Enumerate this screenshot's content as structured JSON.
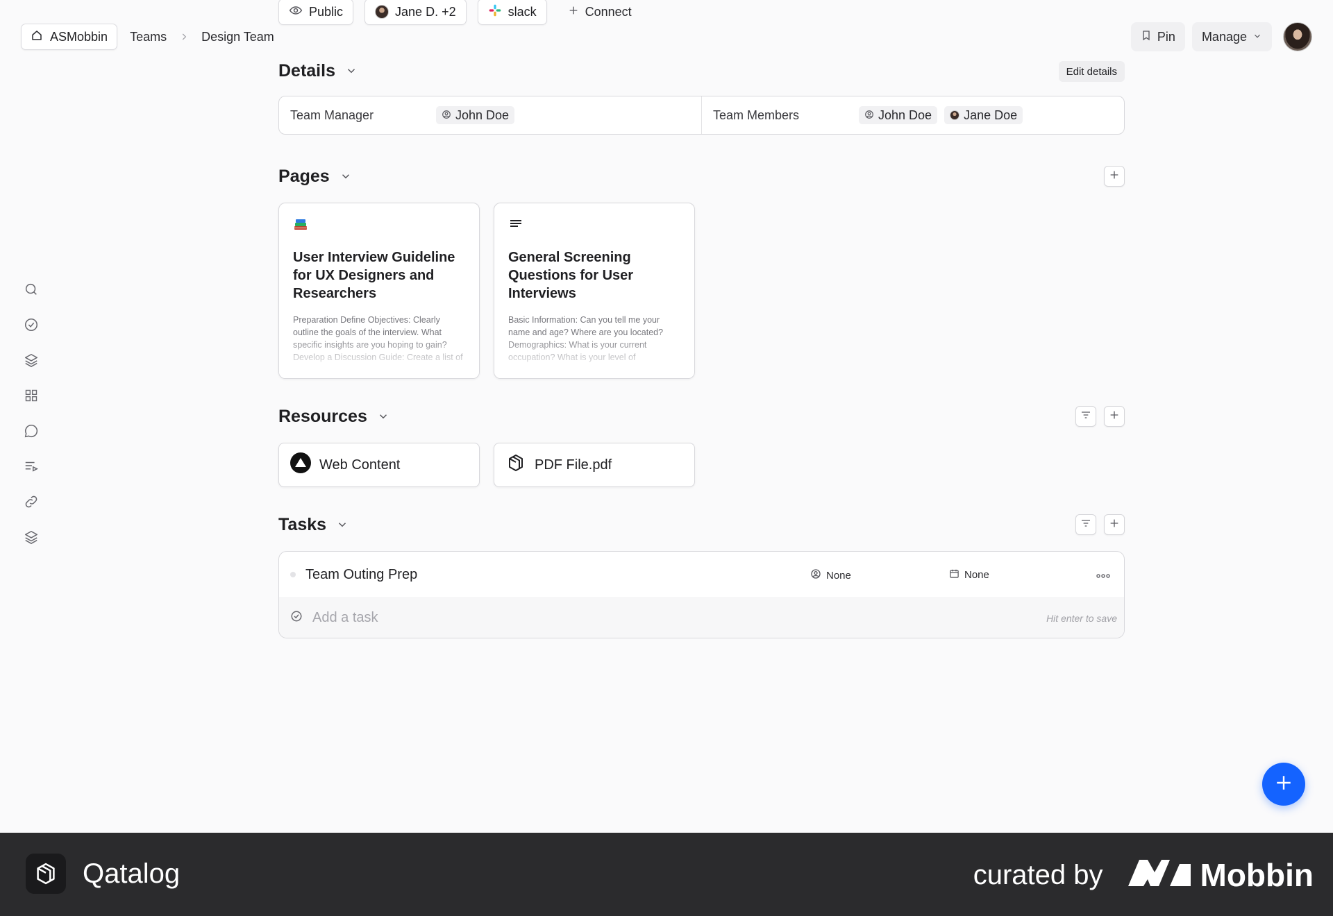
{
  "breadcrumb": {
    "home": "ASMobbin",
    "teams": "Teams",
    "current": "Design Team"
  },
  "top_pills": {
    "visibility": "Public",
    "members": "Jane D. +2",
    "integration": "slack",
    "connect": "Connect"
  },
  "top_actions": {
    "pin": "Pin",
    "manage": "Manage"
  },
  "details": {
    "title": "Details",
    "edit_label": "Edit details",
    "manager_label": "Team Manager",
    "manager": "John Doe",
    "members_label": "Team Members",
    "members": [
      "John Doe",
      "Jane Doe"
    ]
  },
  "pages": {
    "title": "Pages",
    "items": [
      {
        "icon": "books-icon",
        "title": "User Interview Guideline for UX Designers and Researchers",
        "preview": "Preparation Define Objectives: Clearly outline the goals of the interview. What specific insights are you hoping to gain? Develop a Discussion Guide: Create a list of"
      },
      {
        "icon": "text-lines-icon",
        "title": "General Screening Questions for User Interviews",
        "preview": "Basic Information: Can you tell me your name and age? Where are you located? Demographics: What is your current occupation? What is your level of"
      }
    ]
  },
  "resources": {
    "title": "Resources",
    "items": [
      {
        "icon": "triangle-logo-icon",
        "label": "Web Content"
      },
      {
        "icon": "qatalog-logo-icon",
        "label": "PDF File.pdf"
      }
    ]
  },
  "tasks": {
    "title": "Tasks",
    "items": [
      {
        "name": "Team Outing Prep",
        "assignee": "None",
        "due": "None"
      }
    ],
    "add_placeholder": "Add a task",
    "add_hint": "Hit enter to save"
  },
  "footer": {
    "brand": "Qatalog",
    "credit": "curated by",
    "curator": "Mobbin"
  },
  "colors": {
    "accent": "#1463ff",
    "footer_bg": "#2b2b2d",
    "background": "#fafafb"
  }
}
